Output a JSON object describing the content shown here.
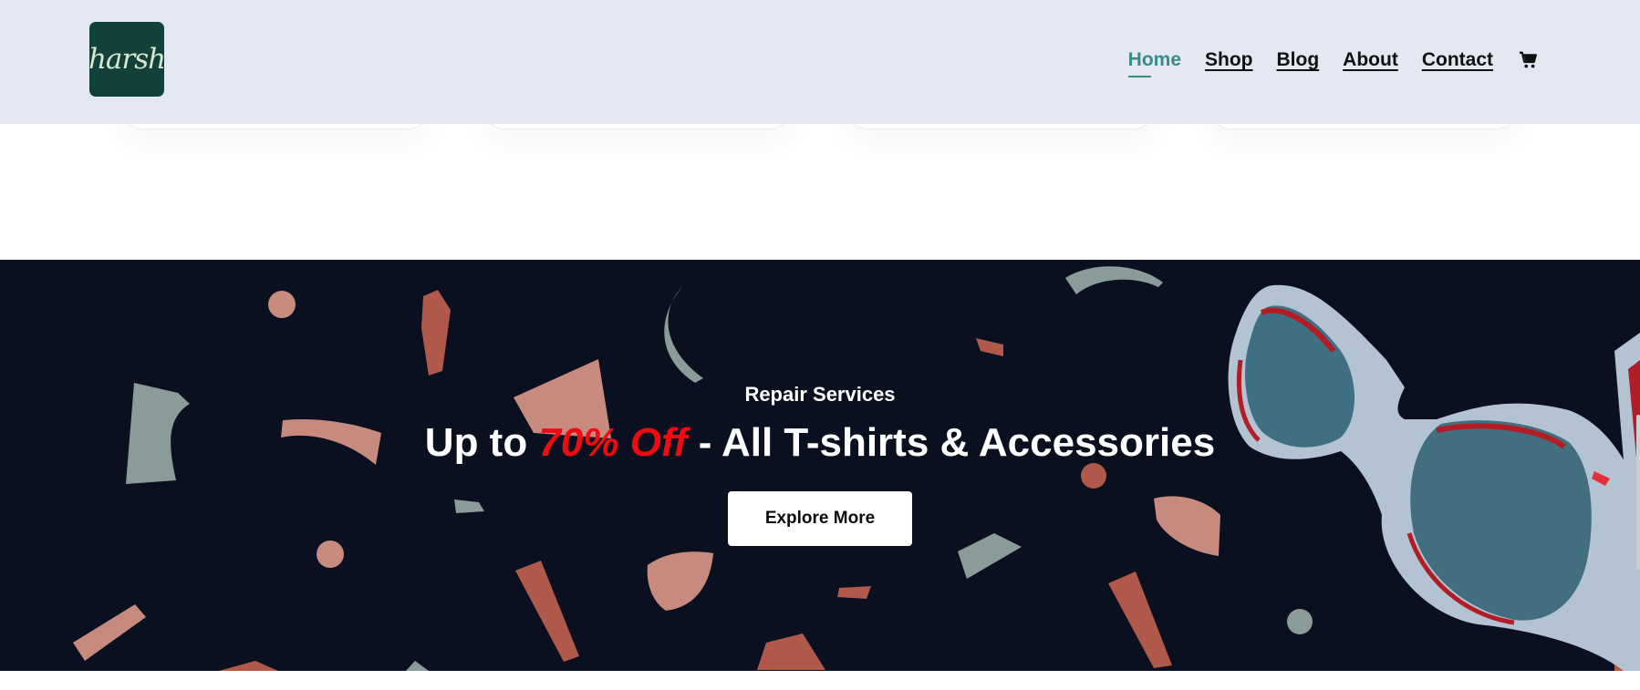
{
  "header": {
    "logo_text": "harsh",
    "nav": [
      {
        "label": "Home",
        "active": true
      },
      {
        "label": "Shop",
        "active": false
      },
      {
        "label": "Blog",
        "active": false
      },
      {
        "label": "About",
        "active": false
      },
      {
        "label": "Contact",
        "active": false
      }
    ],
    "cart_icon": "cart-icon"
  },
  "banner": {
    "eyebrow": "Repair Services",
    "headline_prefix": "Up to ",
    "headline_highlight": "70% Off",
    "headline_suffix": " - All T-shirts & Accessories",
    "cta_label": "Explore More",
    "colors": {
      "background": "#0a101f",
      "highlight": "#f20a12",
      "confetti_red": "#b0594a",
      "confetti_pink": "#c78a7f",
      "confetti_gray": "#8a9c9a"
    }
  },
  "colors": {
    "header_bg": "#e4e8f3",
    "logo_bg": "#12413c",
    "nav_active": "#3b8c86"
  }
}
